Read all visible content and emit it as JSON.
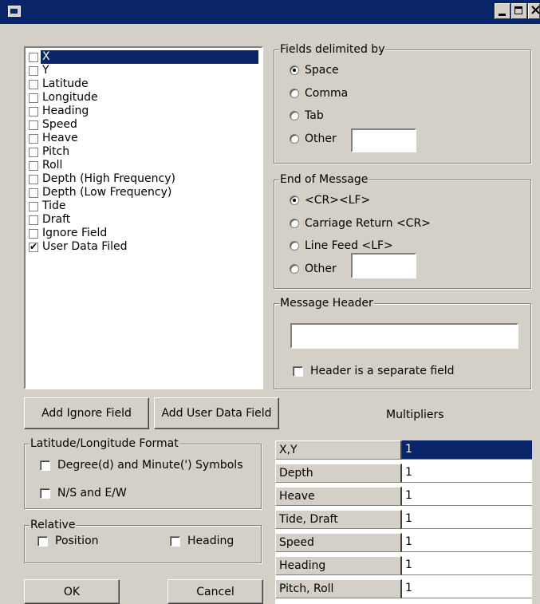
{
  "window": {
    "icon": "app-icon",
    "controls": [
      "minimize",
      "maximize",
      "close"
    ]
  },
  "field_list": {
    "items": [
      {
        "label": "X",
        "checked": false,
        "selected": true
      },
      {
        "label": "Y",
        "checked": false
      },
      {
        "label": "Latitude",
        "checked": false
      },
      {
        "label": "Longitude",
        "checked": false
      },
      {
        "label": "Heading",
        "checked": false
      },
      {
        "label": "Speed",
        "checked": false
      },
      {
        "label": "Heave",
        "checked": false
      },
      {
        "label": "Pitch",
        "checked": false
      },
      {
        "label": "Roll",
        "checked": false
      },
      {
        "label": "Depth (High Frequency)",
        "checked": false
      },
      {
        "label": "Depth (Low Frequency)",
        "checked": false
      },
      {
        "label": "Tide",
        "checked": false
      },
      {
        "label": "Draft",
        "checked": false
      },
      {
        "label": "Ignore Field",
        "checked": false
      },
      {
        "label": "User Data Filed",
        "checked": true
      }
    ]
  },
  "delimiter": {
    "title": "Fields delimited by",
    "options": [
      "Space",
      "Comma",
      "Tab",
      "Other"
    ],
    "selected": "Space",
    "other_value": ""
  },
  "end_of_message": {
    "title": "End of Message",
    "options": [
      "<CR><LF>",
      "Carriage Return <CR>",
      "Line Feed <LF>",
      "Other"
    ],
    "selected": "<CR><LF>",
    "other_value": ""
  },
  "message_header": {
    "title": "Message Header",
    "value": "",
    "separate_label": "Header is a separate field",
    "separate_checked": false
  },
  "buttons": {
    "add_ignore": "Add Ignore Field",
    "add_user": "Add User Data Field",
    "ok": "OK",
    "cancel": "Cancel"
  },
  "multipliers": {
    "title": "Multipliers",
    "rows": [
      {
        "name": "X,Y",
        "value": "1"
      },
      {
        "name": "Depth",
        "value": "1"
      },
      {
        "name": "Heave",
        "value": "1"
      },
      {
        "name": "Tide, Draft",
        "value": "1"
      },
      {
        "name": "Speed",
        "value": "1"
      },
      {
        "name": "Heading",
        "value": "1"
      },
      {
        "name": "Pitch, Roll",
        "value": "1"
      }
    ]
  },
  "latlon_format": {
    "title": "Latitude/Longitude Format",
    "degree_label": "Degree(d) and Minute(') Symbols",
    "ns_label": "N/S and E/W"
  },
  "relative": {
    "title": "Relative",
    "position_label": "Position",
    "heading_label": "Heading"
  }
}
